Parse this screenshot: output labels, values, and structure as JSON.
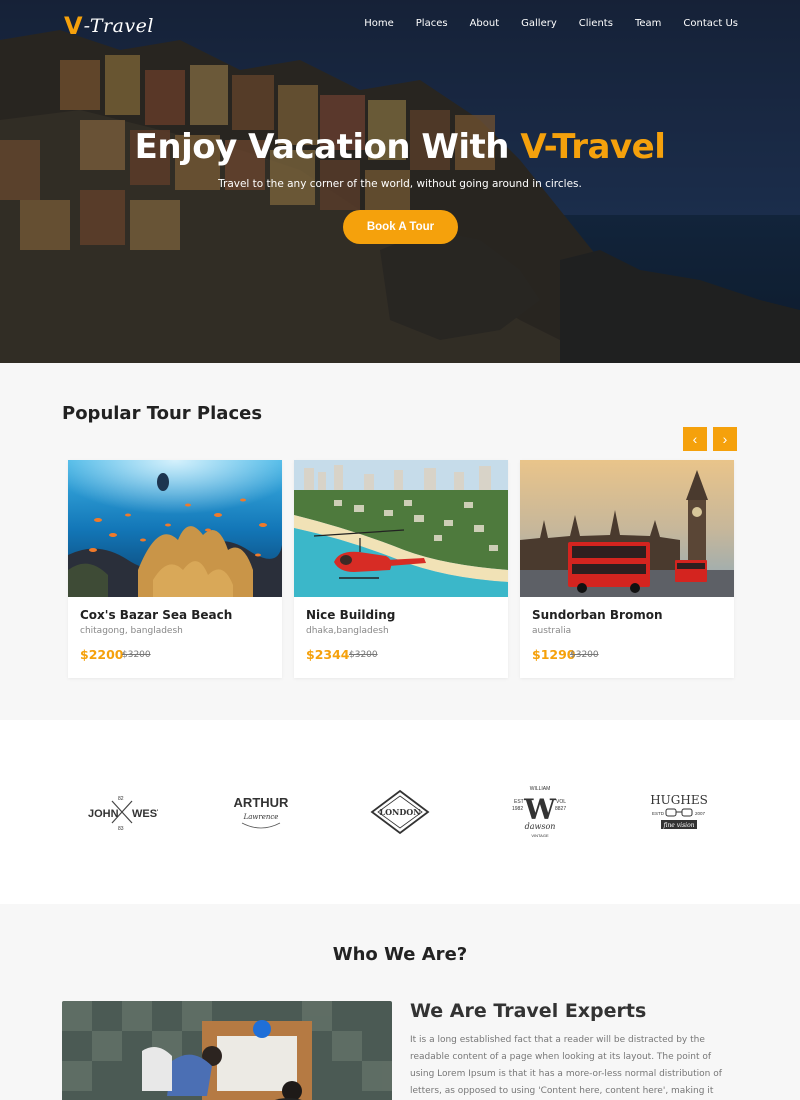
{
  "brand": {
    "logo_v": "V",
    "logo_rest": "-Travel"
  },
  "nav": [
    "Home",
    "Places",
    "About",
    "Gallery",
    "Clients",
    "Team",
    "Contact Us"
  ],
  "hero": {
    "title_main": "Enjoy Vacation With ",
    "title_accent": "V-Travel",
    "subtitle": "Travel to the any corner of the world, without going around in circles.",
    "cta_label": "Book A Tour"
  },
  "popular": {
    "title": "Popular Tour Places",
    "prev_icon": "‹",
    "next_icon": "›",
    "cards": [
      {
        "title": "Cox's Bazar Sea Beach",
        "location": "chitagong, bangladesh",
        "price": "$2200",
        "old_price": "$3200"
      },
      {
        "title": "Nice Building",
        "location": "dhaka,bangladesh",
        "price": "$2344",
        "old_price": "$3200"
      },
      {
        "title": "Sundorban Bromon",
        "location": "australia",
        "price": "$1290",
        "old_price": "$3200"
      }
    ]
  },
  "clients": {
    "john_west": {
      "left": "JOHN",
      "right": "WEST",
      "top_num": "82",
      "bottom_num": "83"
    },
    "arthur": {
      "name": "ARTHUR",
      "script": "Lawrence"
    },
    "london": {
      "name": "LONDON"
    },
    "william": {
      "top": "WILLIAM",
      "letter": "W",
      "est": "EST",
      "year": "1982",
      "vol": "VOL",
      "num": "8827",
      "script": "dawson",
      "bottom": "VINTAGE"
    },
    "hughes": {
      "name": "HUGHES",
      "left": "ESTD",
      "right": "2007",
      "script": "fine vision"
    }
  },
  "who": {
    "title": "Who We Are?",
    "heading": "We Are Travel Experts",
    "text": "It is a long established fact that a reader will be distracted by the readable content of a page when looking at its layout. The point of using Lorem Ipsum is that it has a more-or-less normal distribution of letters, as opposed to using 'Content here, content here', making it look like readable English. Many desktop"
  },
  "colors": {
    "accent": "#f5a10c",
    "section_bg": "#f7f7f7"
  }
}
